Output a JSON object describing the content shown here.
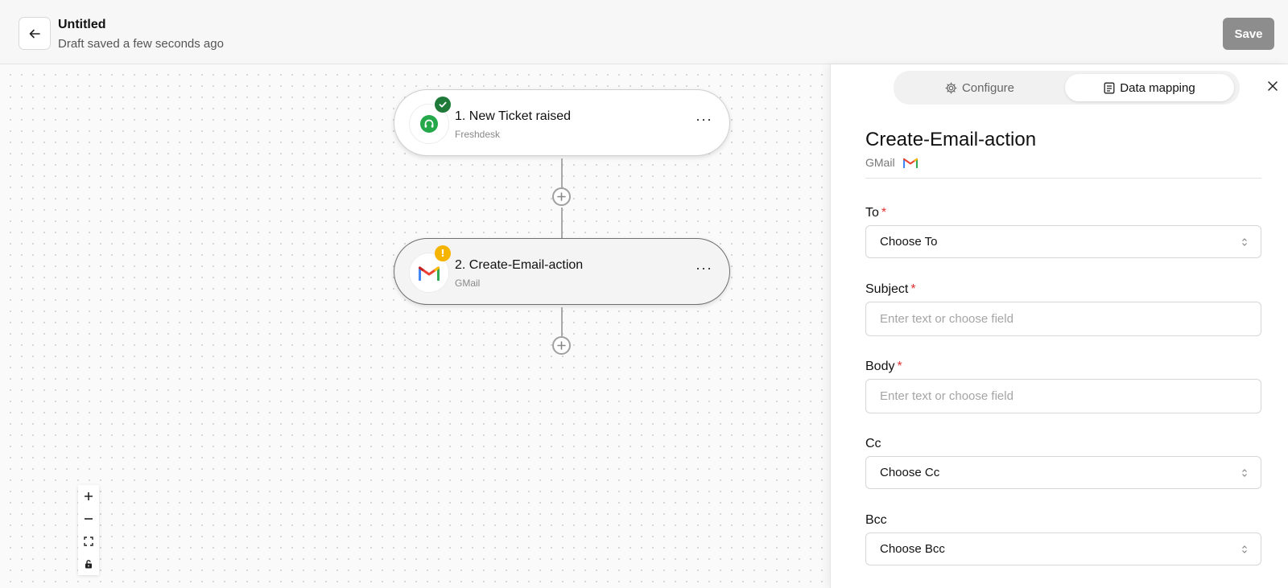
{
  "header": {
    "title": "Untitled",
    "subtitle": "Draft saved a few seconds ago",
    "save_label": "Save",
    "back_icon": "arrow-left-icon"
  },
  "flow": {
    "nodes": [
      {
        "title": "1. New Ticket raised",
        "app": "Freshdesk",
        "status": "complete",
        "icon": "freshdesk-headset-icon"
      },
      {
        "title": "2. Create-Email-action",
        "app": "GMail",
        "status": "warning",
        "icon": "gmail-icon",
        "warning_symbol": "!"
      }
    ],
    "more_label": "···",
    "zoom_controls": [
      "zoom-in",
      "zoom-out",
      "fit-view",
      "lock"
    ]
  },
  "panel": {
    "tabs": [
      {
        "label": "Configure",
        "icon": "gear-icon",
        "active": false
      },
      {
        "label": "Data mapping",
        "icon": "document-icon",
        "active": true
      }
    ],
    "action_title": "Create-Email-action",
    "action_app": "GMail",
    "required_marker": "*",
    "fields": [
      {
        "label": "To",
        "required": true,
        "type": "select",
        "value": "Choose To"
      },
      {
        "label": "Subject",
        "required": true,
        "type": "text",
        "placeholder": "Enter text or choose field"
      },
      {
        "label": "Body",
        "required": true,
        "type": "text",
        "placeholder": "Enter text or choose field"
      },
      {
        "label": "Cc",
        "required": false,
        "type": "select",
        "value": "Choose Cc"
      },
      {
        "label": "Bcc",
        "required": false,
        "type": "select",
        "value": "Choose Bcc"
      }
    ]
  },
  "colors": {
    "success_badge": "#1f7a3a",
    "warning_badge": "#f5b400",
    "required": "#e03131",
    "save_disabled": "#8d8d8d"
  }
}
